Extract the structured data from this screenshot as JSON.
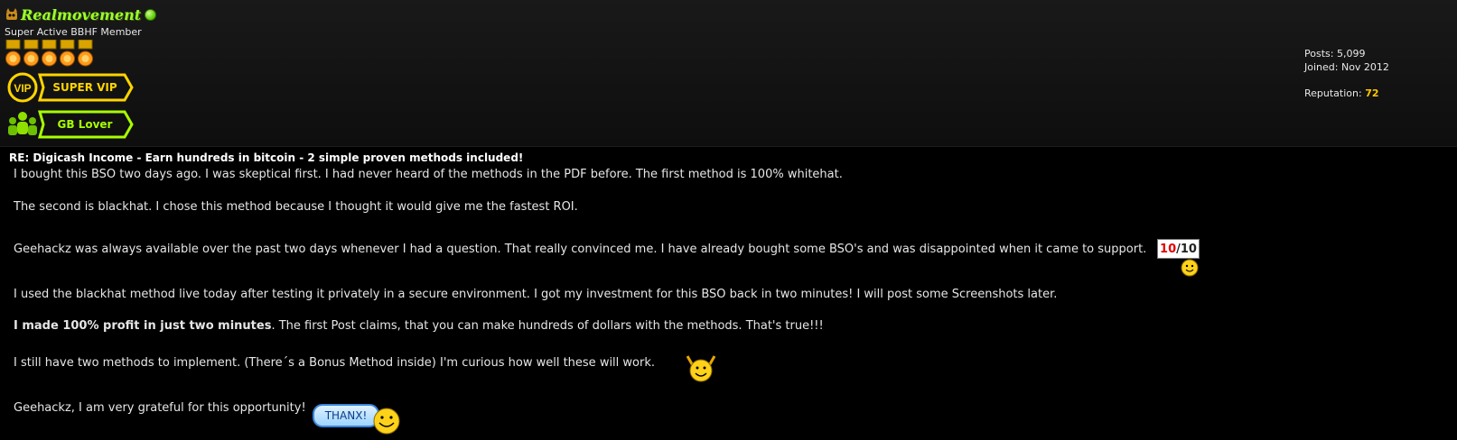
{
  "user": {
    "name": "Realmovement",
    "title": "Super Active BBHF Member",
    "star_count": 5,
    "awards": [
      "SUPER VIP",
      "GB Lover"
    ],
    "vip_badge": "VIP",
    "stats": {
      "posts_label": "Posts:",
      "posts_value": "5,099",
      "joined_label": "Joined:",
      "joined_value": "Nov 2012",
      "reputation_label": "Reputation:",
      "reputation_value": "72"
    }
  },
  "post": {
    "title": "RE: Digicash Income - Earn hundreds in bitcoin - 2 simple proven methods included!",
    "paragraphs": {
      "p1": "I bought this BSO two days ago. I was skeptical first. I had never heard of the methods in the PDF before. The first method is 100% whitehat.",
      "p2": "The second is blackhat. I chose this method because I thought it would give me the fastest ROI.",
      "p3": "Geehackz was always available over the past two days whenever I had a question. That really convinced me. I have already bought some BSO's and was disappointed when it came to support.",
      "p4": "I used the blackhat method live today after testing it privately in a secure environment. I got my investment for this BSO back in two minutes! I will post some Screenshots later.",
      "p5_bold": "I made 100% profit in just two minutes",
      "p5_rest": ". The first Post claims, that you can make hundreds of dollars with the methods. That's true!!!",
      "p6": "I still have two methods to implement. (There´s a Bonus Method inside) I'm curious how well these will work.",
      "p7": "Geehackz, I am very grateful for this opportunity!"
    },
    "score_sign": {
      "score": "10",
      "sep_total": "/10"
    },
    "thanx_text": "THANX!"
  },
  "colors": {
    "username": "#9cff2e",
    "reputation": "#ffc600",
    "background": "#000000",
    "vip_gold": "#ffd400",
    "gb_green": "#a8ff00"
  },
  "icons": [
    "online-status-icon",
    "rank-star-icon",
    "vip-badge-icon",
    "group-people-icon",
    "smiley-sign-icon",
    "smiley-cheer-icon",
    "smiley-thanx-icon"
  ]
}
